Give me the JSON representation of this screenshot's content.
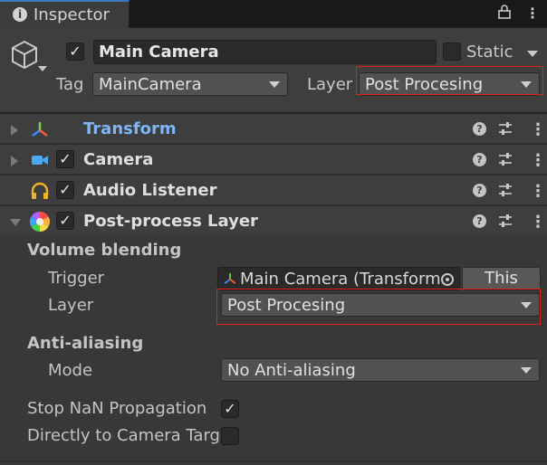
{
  "tab": {
    "title": "Inspector",
    "icon": "info-icon"
  },
  "header": {
    "object_name": "Main Camera",
    "active_checked": true,
    "static_label": "Static",
    "tag_label": "Tag",
    "tag_value": "MainCamera",
    "layer_label": "Layer",
    "layer_value": "Post Procesing"
  },
  "components": [
    {
      "name": "Transform",
      "icon": "transform-icon",
      "has_checkbox": false,
      "expanded": false
    },
    {
      "name": "Camera",
      "icon": "camera-icon",
      "has_checkbox": true,
      "expanded": false
    },
    {
      "name": "Audio Listener",
      "icon": "headphones-icon",
      "has_checkbox": true,
      "expanded": false
    },
    {
      "name": "Post-process Layer",
      "icon": "post-process-icon",
      "has_checkbox": true,
      "expanded": true
    }
  ],
  "post_process": {
    "volume_blending_label": "Volume blending",
    "trigger_label": "Trigger",
    "trigger_value": "Main Camera (Transform",
    "this_button": "This",
    "layer_label": "Layer",
    "layer_value": "Post Procesing",
    "anti_aliasing_label": "Anti-aliasing",
    "mode_label": "Mode",
    "mode_value": "No Anti-aliasing",
    "stop_nan_label": "Stop NaN Propagation",
    "stop_nan_checked": true,
    "direct_to_target_label": "Directly to Camera Targ",
    "direct_to_target_checked": false
  },
  "colors": {
    "accent_tab": "#3a79bb",
    "highlight_box": "#e02020",
    "transform_title": "#7fb4f5"
  }
}
